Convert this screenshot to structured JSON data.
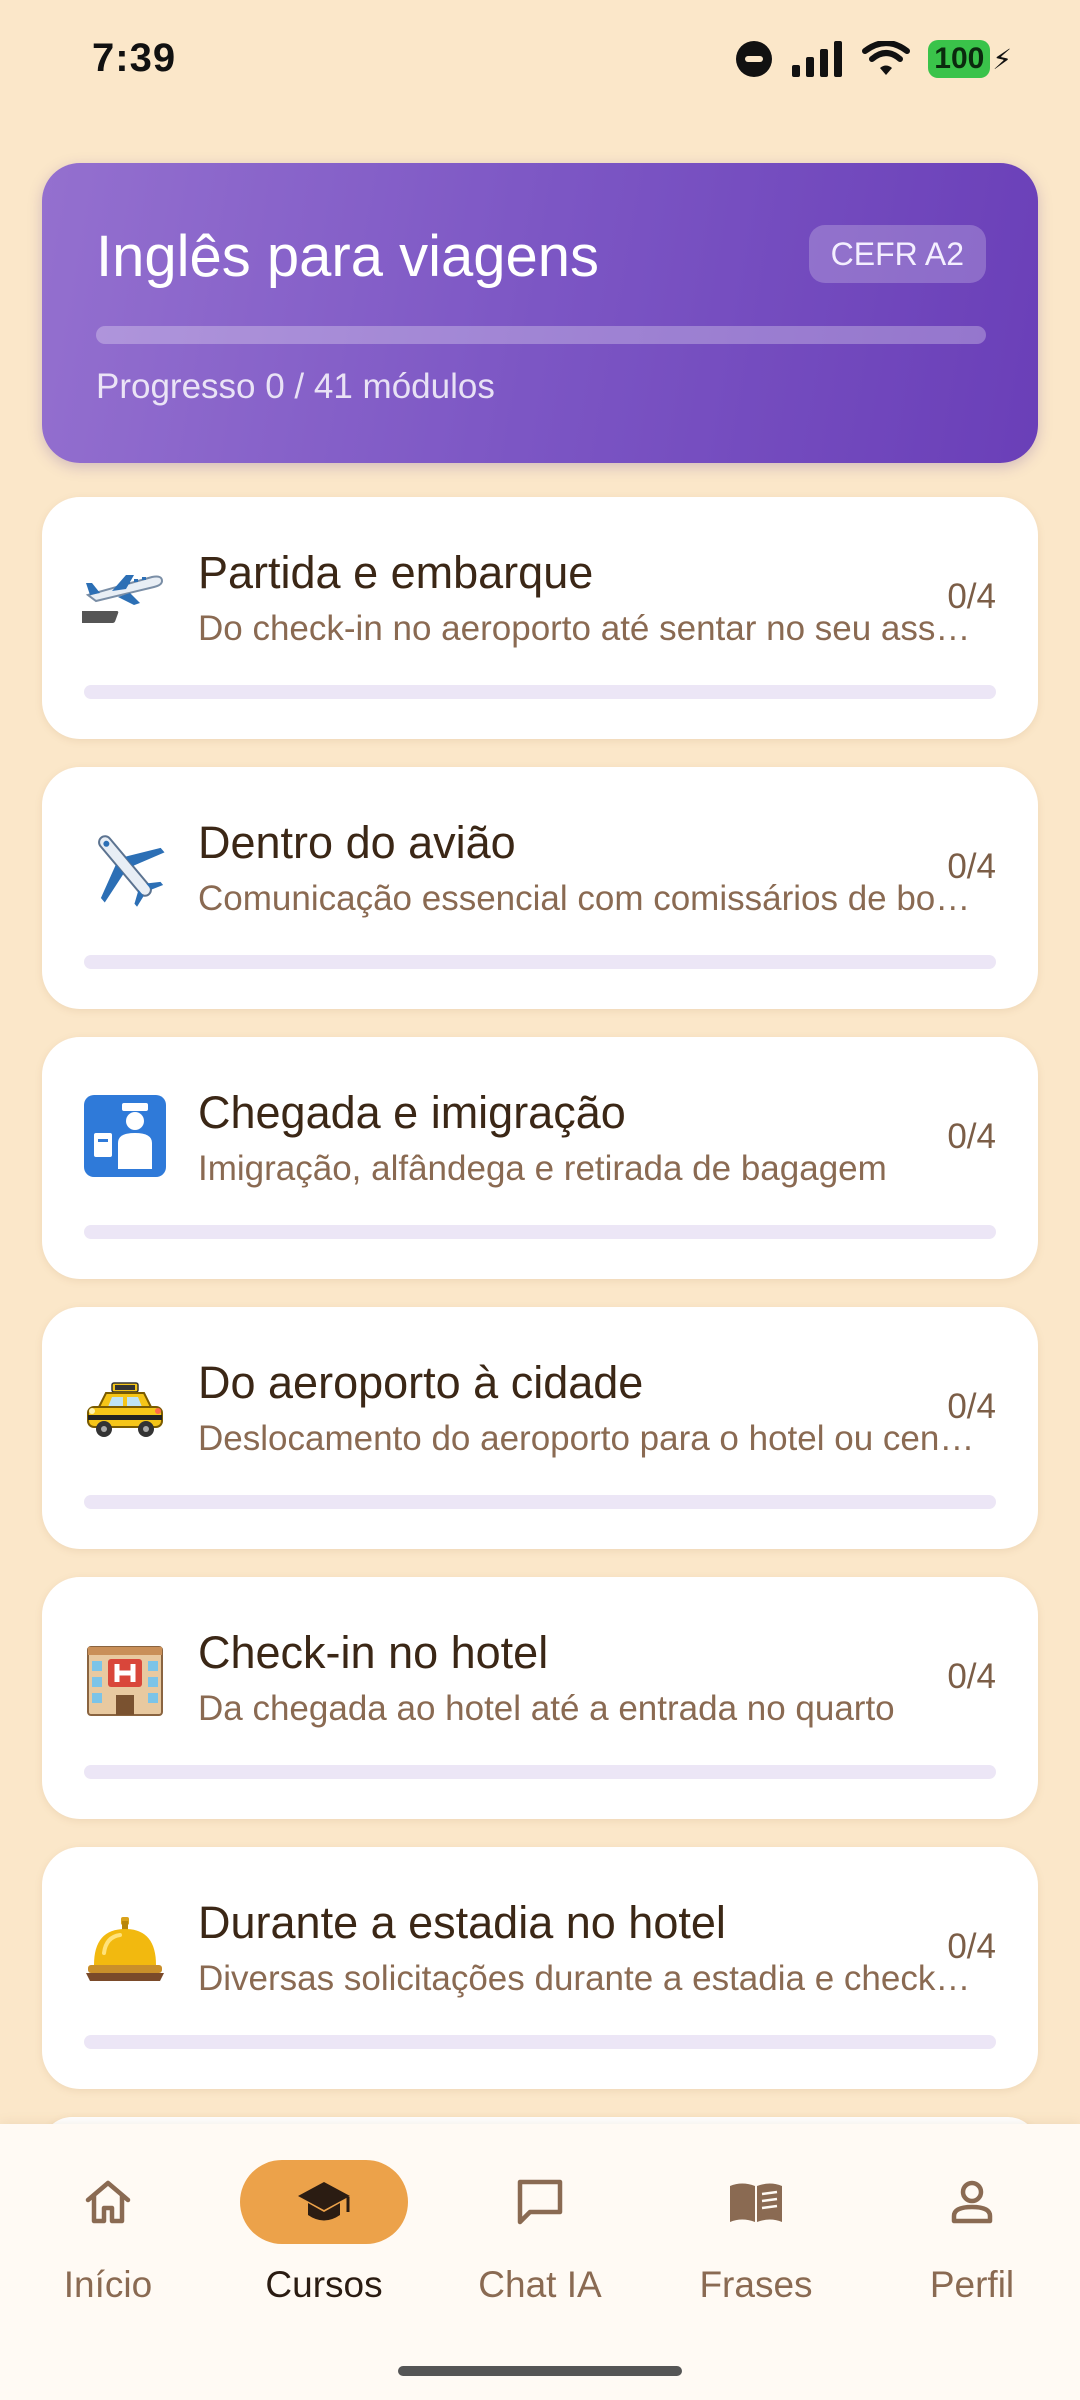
{
  "status_bar": {
    "time": "7:39",
    "battery": "100"
  },
  "header": {
    "title": "Inglês para viagens",
    "badge": "CEFR A2",
    "progress_text": "Progresso 0 / 41 módulos",
    "progress_fraction": 0
  },
  "modules": [
    {
      "icon": "airplane-departure-icon",
      "title": "Partida e embarque",
      "subtitle": "Do check-in no aeroporto até sentar no seu assento",
      "count": "0/4",
      "progress": 0
    },
    {
      "icon": "airplane-icon",
      "title": "Dentro do avião",
      "subtitle": "Comunicação essencial com comissários de bordo",
      "count": "0/4",
      "progress": 0
    },
    {
      "icon": "passport-control-icon",
      "title": "Chegada e imigração",
      "subtitle": "Imigração, alfândega e retirada de bagagem",
      "count": "0/4",
      "progress": 0
    },
    {
      "icon": "taxi-icon",
      "title": "Do aeroporto à cidade",
      "subtitle": "Deslocamento do aeroporto para o hotel ou centro",
      "count": "0/4",
      "progress": 0
    },
    {
      "icon": "hotel-icon",
      "title": "Check-in no hotel",
      "subtitle": "Da chegada ao hotel até a entrada no quarto",
      "count": "0/4",
      "progress": 0
    },
    {
      "icon": "bellhop-bell-icon",
      "title": "Durante a estadia no hotel",
      "subtitle": "Diversas solicitações durante a estadia e check-out",
      "count": "0/4",
      "progress": 0
    }
  ],
  "nav": {
    "items": [
      {
        "label": "Início",
        "icon": "home-icon"
      },
      {
        "label": "Cursos",
        "icon": "graduation-cap-icon",
        "active": true
      },
      {
        "label": "Chat IA",
        "icon": "chat-bubble-icon"
      },
      {
        "label": "Frases",
        "icon": "book-icon"
      },
      {
        "label": "Perfil",
        "icon": "person-icon"
      }
    ]
  },
  "colors": {
    "background": "#fbe7c9",
    "accent": "#7c56c4",
    "nav_active": "#eca24a"
  }
}
